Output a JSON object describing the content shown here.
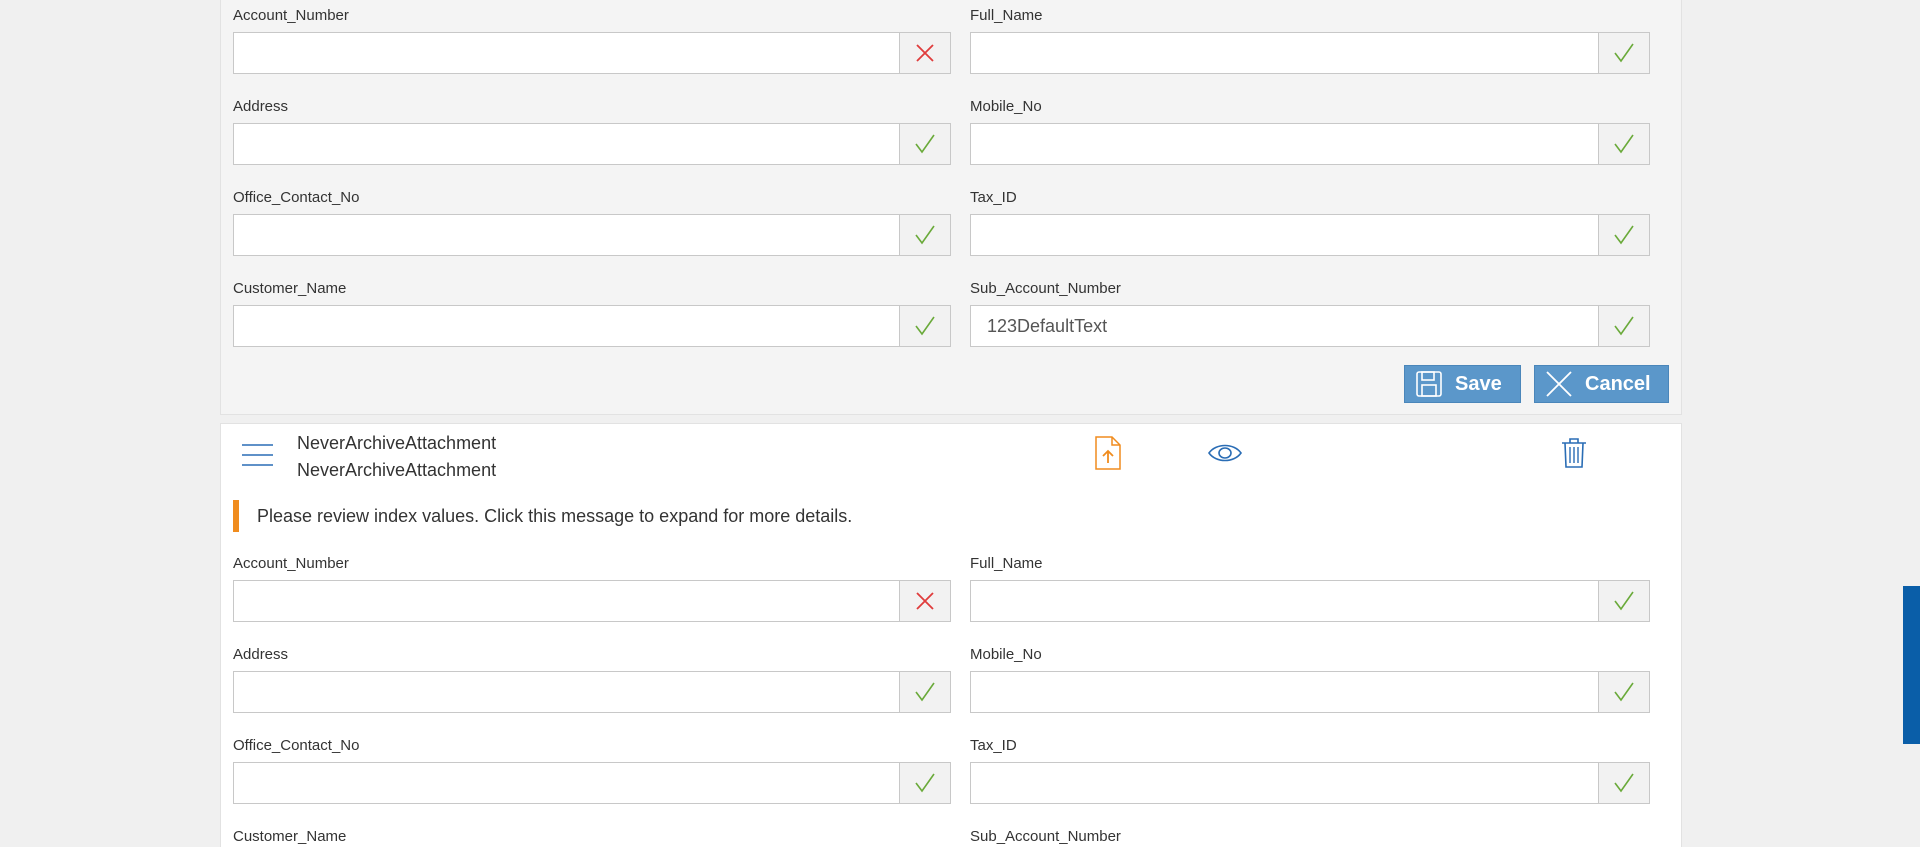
{
  "form_top": {
    "fields": [
      {
        "label": "Account_Number",
        "value": "",
        "status": "invalid"
      },
      {
        "label": "Full_Name",
        "value": "",
        "status": "valid"
      },
      {
        "label": "Address",
        "value": "",
        "status": "valid"
      },
      {
        "label": "Mobile_No",
        "value": "",
        "status": "valid"
      },
      {
        "label": "Office_Contact_No",
        "value": "",
        "status": "valid"
      },
      {
        "label": "Tax_ID",
        "value": "",
        "status": "valid"
      },
      {
        "label": "Customer_Name",
        "value": "",
        "status": "valid"
      },
      {
        "label": "Sub_Account_Number",
        "value": "123DefaultText",
        "status": "valid"
      }
    ],
    "save_label": "Save",
    "cancel_label": "Cancel"
  },
  "attachment": {
    "name_line1": "NeverArchiveAttachment",
    "name_line2": "NeverArchiveAttachment",
    "icons": [
      "menu-icon",
      "upload-file-icon",
      "eye-icon",
      "trash-icon"
    ],
    "message": "Please review index values. Click this message to expand for more details.",
    "fields": [
      {
        "label": "Account_Number",
        "value": "",
        "status": "invalid"
      },
      {
        "label": "Full_Name",
        "value": "",
        "status": "valid"
      },
      {
        "label": "Address",
        "value": "",
        "status": "valid"
      },
      {
        "label": "Mobile_No",
        "value": "",
        "status": "valid"
      },
      {
        "label": "Office_Contact_No",
        "value": "",
        "status": "valid"
      },
      {
        "label": "Tax_ID",
        "value": "",
        "status": "valid"
      },
      {
        "label": "Customer_Name"
      },
      {
        "label": "Sub_Account_Number"
      }
    ]
  },
  "colors": {
    "accent": "#5b97ca",
    "valid": "#6aaa3a",
    "invalid": "#e03c3c",
    "warning": "#f08c1e",
    "icon_blue": "#2a6db5",
    "scrollbar": "#0a5ea8"
  }
}
